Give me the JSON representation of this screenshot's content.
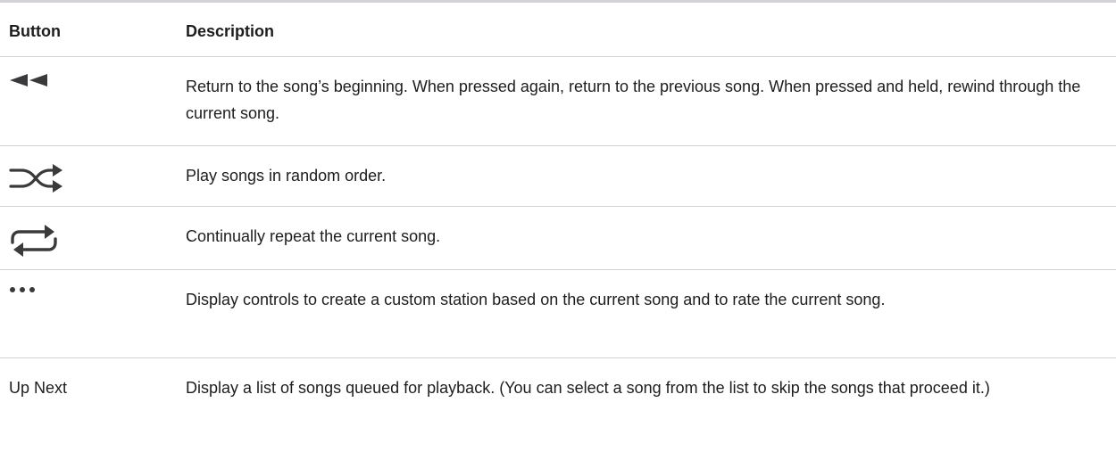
{
  "table": {
    "headers": {
      "button": "Button",
      "description": "Description"
    },
    "rows": [
      {
        "icon": "rewind-icon",
        "description": "Return to the song’s beginning. When pressed again, return to the previous song. When pressed and held, rewind through the current song."
      },
      {
        "icon": "shuffle-icon",
        "description": "Play songs in random order."
      },
      {
        "icon": "repeat-icon",
        "description": "Continually repeat the current song."
      },
      {
        "icon": "more-icon",
        "description": "Display controls to create a custom station based on the current song and to rate the current song."
      },
      {
        "label": "Up Next",
        "description": "Display a list of songs queued for playback. (You can select a song from the list to skip the songs that proceed it.)"
      }
    ]
  },
  "colors": {
    "text": "#1d1d1f",
    "icon": "#3a3a3c",
    "rule": "#d2d2d7"
  }
}
